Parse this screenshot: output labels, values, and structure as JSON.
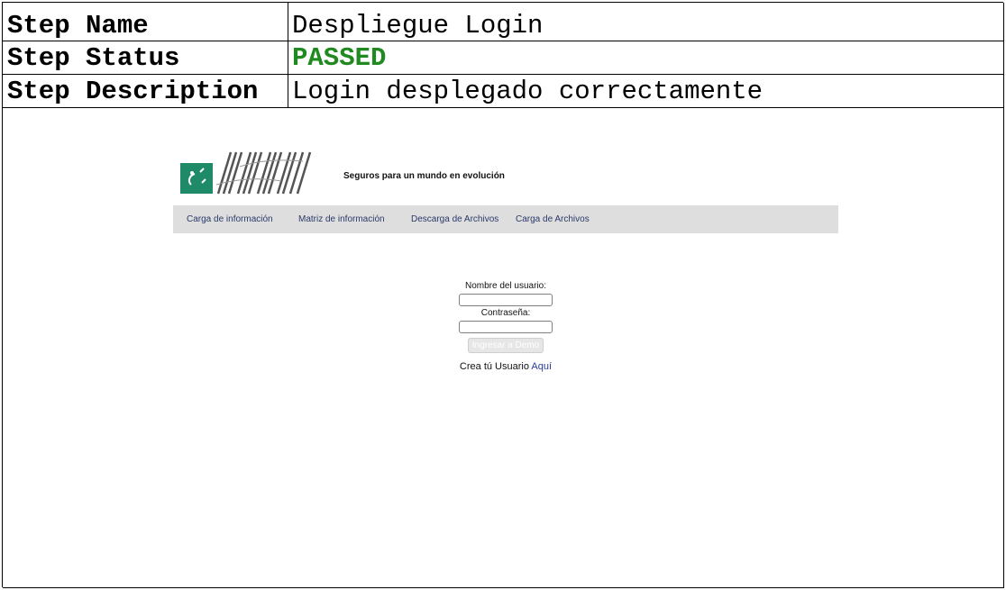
{
  "report": {
    "rows": [
      {
        "label": "Step Name",
        "value": "Despliegue Login"
      },
      {
        "label": "Step Status",
        "value": "PASSED"
      },
      {
        "label": "Step Description",
        "value": "Login desplegado correctamente"
      }
    ],
    "status_color": "#208a20"
  },
  "app": {
    "logo_icon": "bank-logo-icon",
    "wordmark_icon": "striped-wordmark-icon",
    "tagline": "Seguros para un mundo en evolución",
    "nav": [
      "Carga de información",
      "Matriz de información",
      "Descarga de Archivos",
      "Carga de Archivos"
    ],
    "login": {
      "username_label": "Nombre del usuario:",
      "username_value": "",
      "password_label": "Contraseña:",
      "password_value": "",
      "submit_label": "Ingresar a Demo",
      "register_text": "Crea tú Usuario",
      "register_link": "Aquí"
    },
    "colors": {
      "navbar_bg": "#dedede",
      "nav_link": "#2a3a6a",
      "logo_green": "#1f8a67"
    }
  }
}
